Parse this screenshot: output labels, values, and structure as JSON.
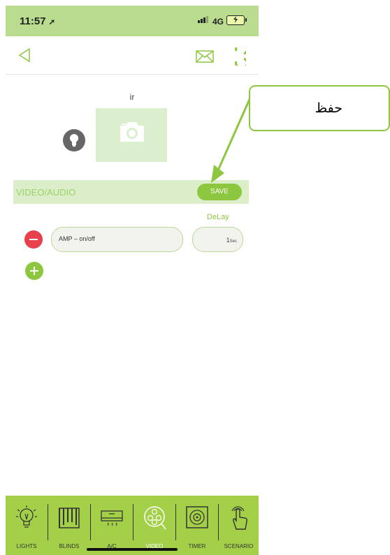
{
  "status_bar": {
    "time": "11:57",
    "network": "4G"
  },
  "navbar": {
    "back_icon": "back-chevron-icon",
    "mail_icon": "envelope-icon",
    "refresh_icon": "refresh-icon"
  },
  "device": {
    "name": "ir"
  },
  "section": {
    "title": "VIDEO/AUDIO",
    "save_label": "SAVE"
  },
  "command_row": {
    "delay_header": "DeLay",
    "command": "AMP – on/off",
    "delay_value": "1",
    "delay_unit": "Sec"
  },
  "tabs": [
    {
      "label": "LIGHTS",
      "icon": "lightbulb-icon"
    },
    {
      "label": "BLINDS",
      "icon": "blinds-icon"
    },
    {
      "label": "A/C",
      "icon": "air-conditioner-icon"
    },
    {
      "label": "VIDEO",
      "icon": "film-reel-icon"
    },
    {
      "label": "TIMER",
      "icon": "timer-icon"
    },
    {
      "label": "SCENARIO",
      "icon": "touch-hand-icon"
    }
  ],
  "annotation": {
    "text": "حفظ"
  },
  "colors": {
    "accent": "#8dc63f",
    "status_bar": "#b9dc8f",
    "tab_bar": "#a3d048",
    "remove": "#e5404b"
  }
}
